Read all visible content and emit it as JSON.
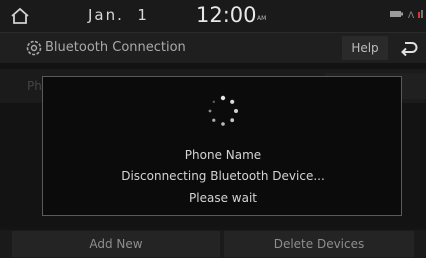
{
  "status": {
    "date": "Jan.  1",
    "time": "12:00",
    "ampm": "AM"
  },
  "header": {
    "title": "Bluetooth Connection",
    "help_label": "Help"
  },
  "list": {
    "first_row_label": "Ph"
  },
  "dialog": {
    "device_name": "Phone Name",
    "status_text": "Disconnecting Bluetooth Device...",
    "wait_text": "Please wait"
  },
  "bottom": {
    "add_new_label": "Add New",
    "delete_devices_label": "Delete Devices"
  },
  "icons": {
    "home": "home-icon",
    "settings": "gear-icon",
    "back": "back-arrow-icon",
    "spinner": "loading-spinner-icon",
    "battery": "battery-icon",
    "signal": "signal-icon"
  }
}
